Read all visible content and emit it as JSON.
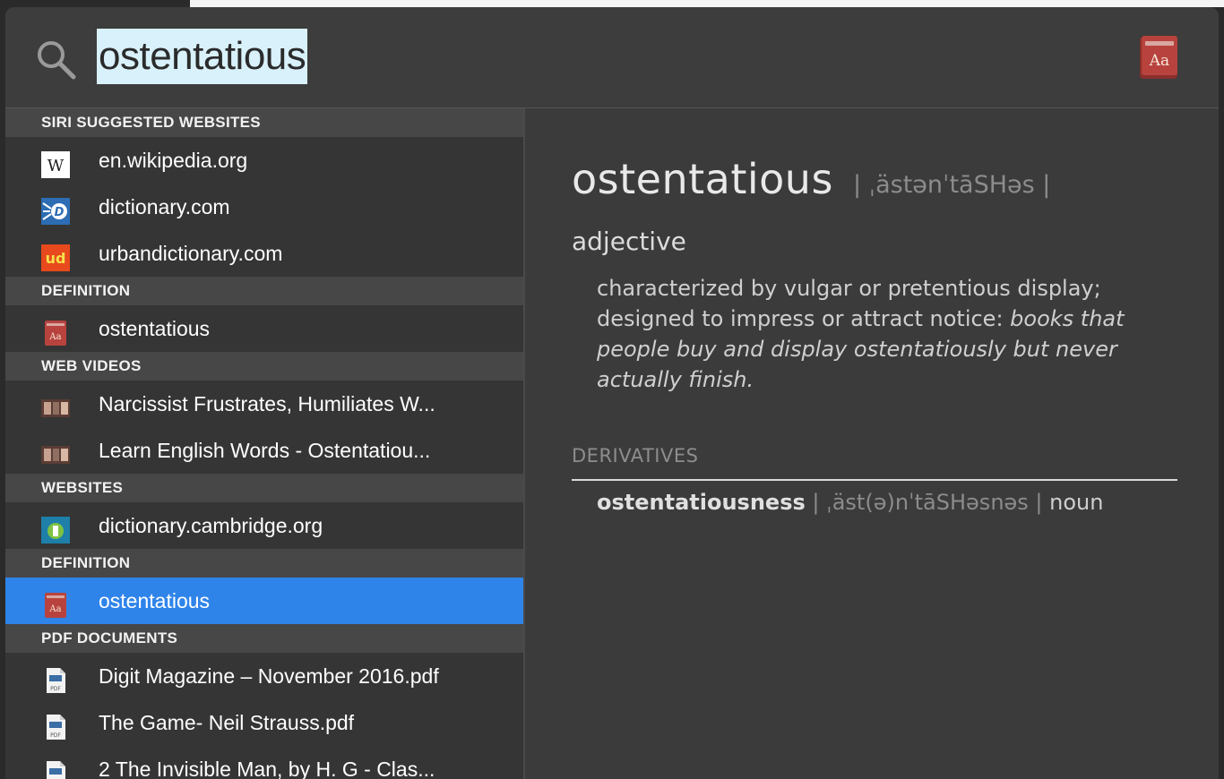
{
  "search": {
    "query": "ostentatious"
  },
  "sections": [
    {
      "header": "SIRI SUGGESTED WEBSITES",
      "items": [
        {
          "label": "en.wikipedia.org",
          "icon": "wikipedia-icon"
        },
        {
          "label": "dictionary.com",
          "icon": "dictionary-com-icon"
        },
        {
          "label": "urbandictionary.com",
          "icon": "urban-dictionary-icon"
        }
      ]
    },
    {
      "header": "DEFINITION",
      "items": [
        {
          "label": "ostentatious",
          "icon": "dictionary-icon"
        }
      ]
    },
    {
      "header": "WEB VIDEOS",
      "items": [
        {
          "label": "Narcissist Frustrates, Humiliates W...",
          "icon": "video-thumbnail-icon"
        },
        {
          "label": "Learn English Words - Ostentatiou...",
          "icon": "video-thumbnail-icon"
        }
      ]
    },
    {
      "header": "WEBSITES",
      "items": [
        {
          "label": "dictionary.cambridge.org",
          "icon": "cambridge-icon"
        }
      ]
    },
    {
      "header": "DEFINITION",
      "items": [
        {
          "label": "ostentatious",
          "icon": "dictionary-icon",
          "selected": true
        }
      ]
    },
    {
      "header": "PDF DOCUMENTS",
      "items": [
        {
          "label": "Digit Magazine – November 2016.pdf",
          "icon": "pdf-icon"
        },
        {
          "label": "The Game- Neil Strauss.pdf",
          "icon": "pdf-icon"
        },
        {
          "label": "2 The Invisible Man, by H. G - Clas...",
          "icon": "pdf-icon"
        }
      ]
    }
  ],
  "detail": {
    "headword": "ostentatious",
    "pronunciation": "| ˌästənˈtāSHəs |",
    "part_of_speech": "adjective",
    "definition": "characterized by vulgar or pretentious display; designed to impress or attract notice: ",
    "example": "books that people buy and display ostentatiously but never actually finish.",
    "derivatives_header": "DERIVATIVES",
    "derivative_word": "ostentatiousness",
    "derivative_pron": " | ˌäst(ə)nˈtāSHəsnəs | ",
    "derivative_pos": "noun"
  },
  "colors": {
    "selection": "#2f84ea",
    "background": "#3a3a3a",
    "search_highlight": "#d8f1fb"
  }
}
